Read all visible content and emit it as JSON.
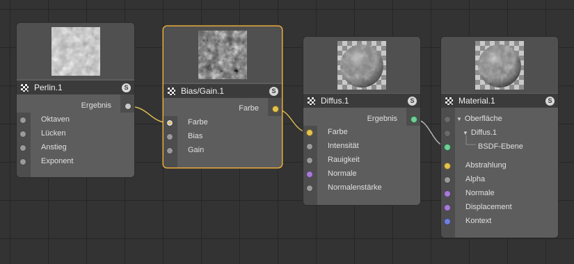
{
  "nodes": {
    "perlin": {
      "title": "Perlin.1",
      "solo": "S",
      "output": "Ergebnis",
      "inputs": [
        "Oktaven",
        "Lücken",
        "Anstieg",
        "Exponent"
      ]
    },
    "bias": {
      "title": "Bias/Gain.1",
      "solo": "S",
      "output": "Farbe",
      "inputs": [
        "Farbe",
        "Bias",
        "Gain"
      ]
    },
    "diffus": {
      "title": "Diffus.1",
      "solo": "S",
      "output": "Ergebnis",
      "inputs": [
        "Farbe",
        "Intensität",
        "Rauigkeit",
        "Normale",
        "Normalenstärke"
      ]
    },
    "material": {
      "title": "Material.1",
      "solo": "S",
      "tree": [
        "Oberfläche",
        "Diffus.1",
        "BSDF-Ebene"
      ],
      "inputs": [
        "Abstrahlung",
        "Alpha",
        "Normale",
        "Displacement",
        "Kontext"
      ]
    }
  },
  "colors": {
    "canvas": "#333333",
    "selected_outline": "#e9ad3a",
    "color_port": "#e3c252",
    "shader_port": "#6fcf97",
    "vector_port": "#a77ad4",
    "context_port": "#7080d9"
  }
}
